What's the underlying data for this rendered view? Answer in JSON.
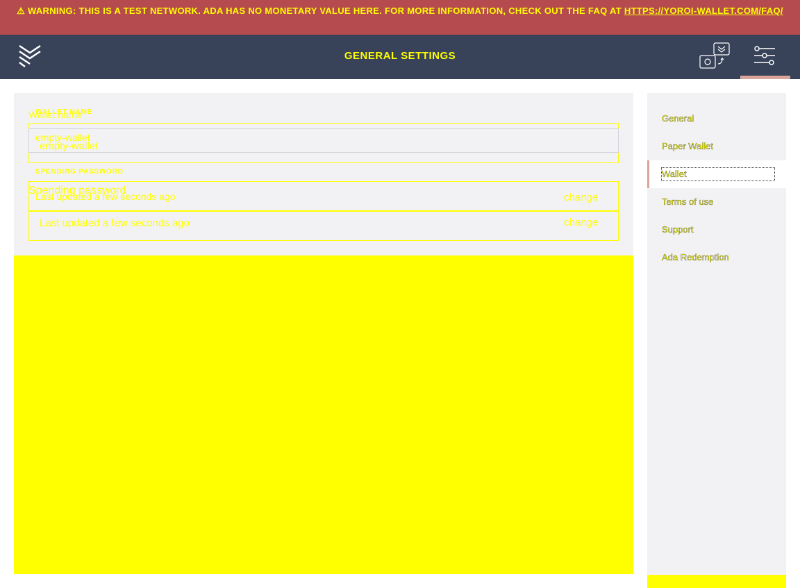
{
  "banner": {
    "icon": "warning-icon",
    "text": "WARNING: THIS IS A TEST NETWORK. ADA HAS NO MONETARY VALUE HERE. FOR MORE INFORMATION, CHECK OUT THE FAQ AT ",
    "link": "HTTPS://YOROI-WALLET.COM/FAQ/"
  },
  "topbar": {
    "title": "GENERAL SETTINGS",
    "logo_icon": "yoroi-logo-icon",
    "wallet_icon": "transfer-wallet-icon",
    "settings_icon": "sliders-icon"
  },
  "form": {
    "wallet_name_label": "WALLET NAME",
    "wallet_name_label_alt": "Wallet name",
    "wallet_name_value": "empty-wallet",
    "password_label": "SPENDING PASSWORD",
    "password_label_alt": "Spending password",
    "password_status": "Last updated a few seconds ago",
    "change": "change"
  },
  "sidebar": {
    "items": [
      {
        "label": "General"
      },
      {
        "label": "Paper Wallet"
      },
      {
        "label": "Wallet",
        "active": true
      },
      {
        "label": "Terms of use"
      },
      {
        "label": "Support"
      },
      {
        "label": "Ada Redemption"
      }
    ]
  },
  "colors": {
    "banner": "#b54b4f",
    "topbar": "#38435a",
    "accent": "#daa49a",
    "panel": "#f2f2f4",
    "overlay": "#ffff00"
  }
}
